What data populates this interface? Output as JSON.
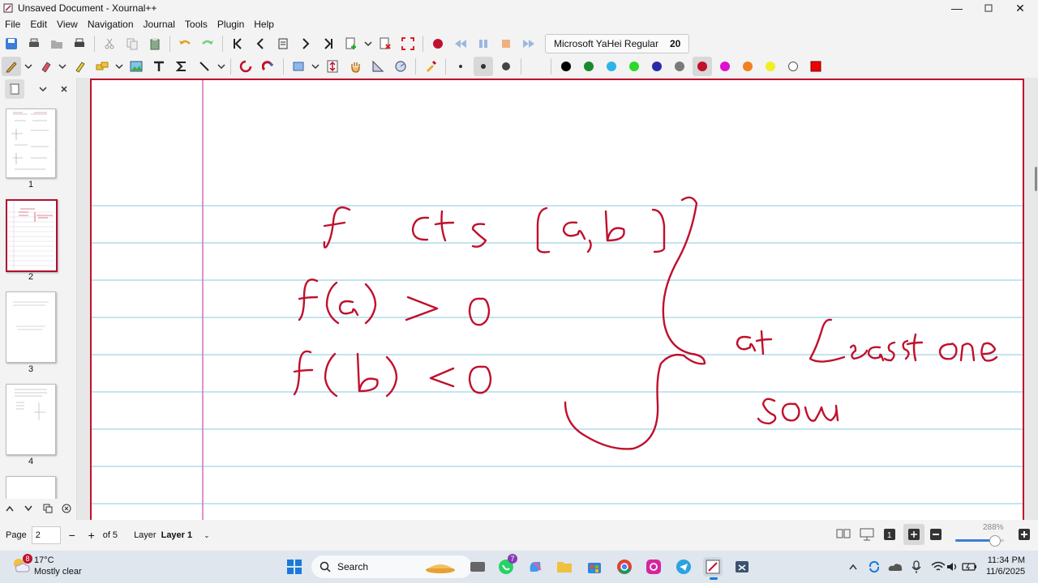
{
  "window": {
    "title": "Unsaved Document - Xournal++"
  },
  "menu": [
    "File",
    "Edit",
    "View",
    "Navigation",
    "Journal",
    "Tools",
    "Plugin",
    "Help"
  ],
  "font_selector": {
    "name": "Microsoft YaHei Regular",
    "size": "20"
  },
  "palette": {
    "colors": [
      "#000000",
      "#1a8a2e",
      "#2cb5e8",
      "#2dd82d",
      "#2a2aa8",
      "#7a7a7a",
      "#c0102c",
      "#e010d0",
      "#f08020",
      "#f0f020",
      "#ffffff"
    ],
    "selected": "#c0102c",
    "accent": "#c0102c"
  },
  "sidebar": {
    "pages": [
      {
        "number": "1"
      },
      {
        "number": "2"
      },
      {
        "number": "3"
      },
      {
        "number": "4"
      }
    ]
  },
  "status": {
    "page_label": "Page",
    "page_value": "2",
    "minus": "−",
    "plus": "+",
    "of_label": "of 5",
    "layer_label": "Layer",
    "layer_value": "Layer 1",
    "zoom": "288%"
  },
  "taskbar": {
    "weather_temp": "17°C",
    "weather_desc": "Mostly clear",
    "weather_badge": "8",
    "search_label": "Search",
    "whatsapp_badge": "7",
    "time": "11:34 PM",
    "date": "11/6/2025"
  }
}
